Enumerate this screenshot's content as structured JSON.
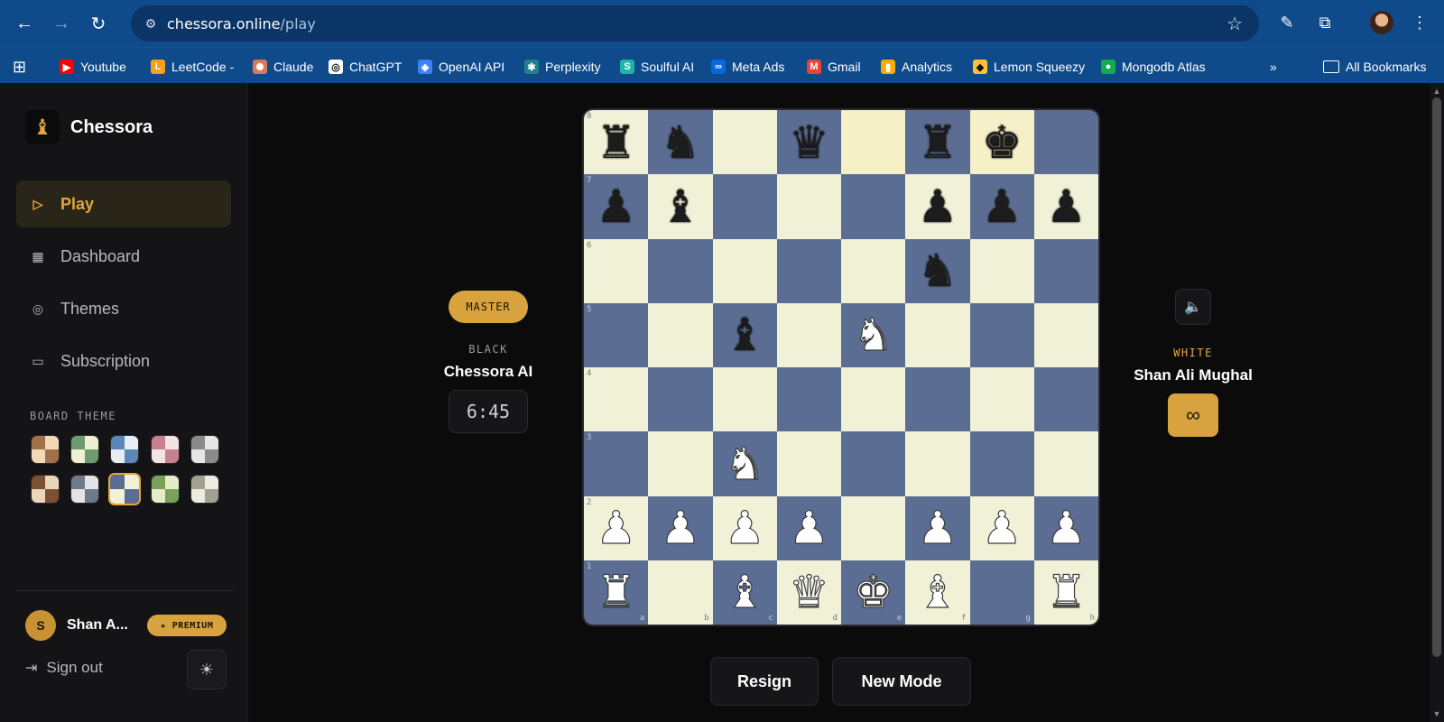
{
  "browser": {
    "url_domain": "chessora.online",
    "url_path": "/play",
    "bookmarks": [
      {
        "label": "Youtube",
        "icon": "youtube-icon",
        "color": "#ff0000"
      },
      {
        "label": "LeetCode -",
        "icon": "leetcode-icon",
        "color": "#f89f1b"
      },
      {
        "label": "Claude",
        "icon": "claude-icon",
        "color": "#d97757"
      },
      {
        "label": "ChatGPT",
        "icon": "chatgpt-icon",
        "color": "#ffffff"
      },
      {
        "label": "OpenAI API",
        "icon": "openai-icon",
        "color": "#3b82f6"
      },
      {
        "label": "Perplexity",
        "icon": "perplexity-icon",
        "color": "#20808d"
      },
      {
        "label": "Soulful AI",
        "icon": "soulful-icon",
        "color": "#1fb5a6"
      },
      {
        "label": "Meta Ads",
        "icon": "meta-icon",
        "color": "#0668e1"
      },
      {
        "label": "Gmail",
        "icon": "gmail-icon",
        "color": "#ea4335"
      },
      {
        "label": "Analytics",
        "icon": "analytics-icon",
        "color": "#f9ab00"
      },
      {
        "label": "Lemon Squeezy",
        "icon": "lemon-icon",
        "color": "#ffc233"
      },
      {
        "label": "Mongodb Atlas",
        "icon": "mongodb-icon",
        "color": "#13aa52"
      }
    ],
    "all_bookmarks": "All Bookmarks"
  },
  "app": {
    "brand": "Chessora",
    "nav": [
      {
        "label": "Play",
        "icon": "play-icon",
        "active": true
      },
      {
        "label": "Dashboard",
        "icon": "dashboard-icon",
        "active": false
      },
      {
        "label": "Themes",
        "icon": "palette-icon",
        "active": false
      },
      {
        "label": "Subscription",
        "icon": "card-icon",
        "active": false
      }
    ],
    "board_theme_label": "BOARD THEME",
    "themes": [
      {
        "light": "#f0d9b5",
        "dark": "#a0714a"
      },
      {
        "light": "#eeeed2",
        "dark": "#6e9a6e"
      },
      {
        "light": "#e8edf5",
        "dark": "#5a86b8"
      },
      {
        "light": "#f3e4e4",
        "dark": "#c9808e"
      },
      {
        "light": "#e5e5e5",
        "dark": "#8a8a8a"
      },
      {
        "light": "#ead6b8",
        "dark": "#7b5033"
      },
      {
        "light": "#e3e3e3",
        "dark": "#6c7a8a"
      },
      {
        "light": "#f1f1d8",
        "dark": "#5b6d93"
      },
      {
        "light": "#e6edc6",
        "dark": "#7aa05a"
      },
      {
        "light": "#ecebe0",
        "dark": "#a49f8e"
      }
    ],
    "selected_theme": 7,
    "user": {
      "initial": "S",
      "name": "Shan A...",
      "plan": "★ PREMIUM"
    },
    "signout": "Sign out"
  },
  "game": {
    "black": {
      "badge": "MASTER",
      "side": "BLACK",
      "name": "Chessora AI",
      "clock": "6:45"
    },
    "white": {
      "side": "WHITE",
      "name": "Shan Ali Mughal",
      "clock": "∞"
    },
    "board_rows": [
      "rn.q.rk.",
      "pb...ppp",
      ".....n..",
      "..b.N...",
      "........",
      "..N.....",
      "PPPP.PPP",
      "R.BQKB.R"
    ],
    "highlight": [
      "e8",
      "g8"
    ],
    "buttons": {
      "resign": "Resign",
      "new_mode": "New Mode"
    }
  }
}
